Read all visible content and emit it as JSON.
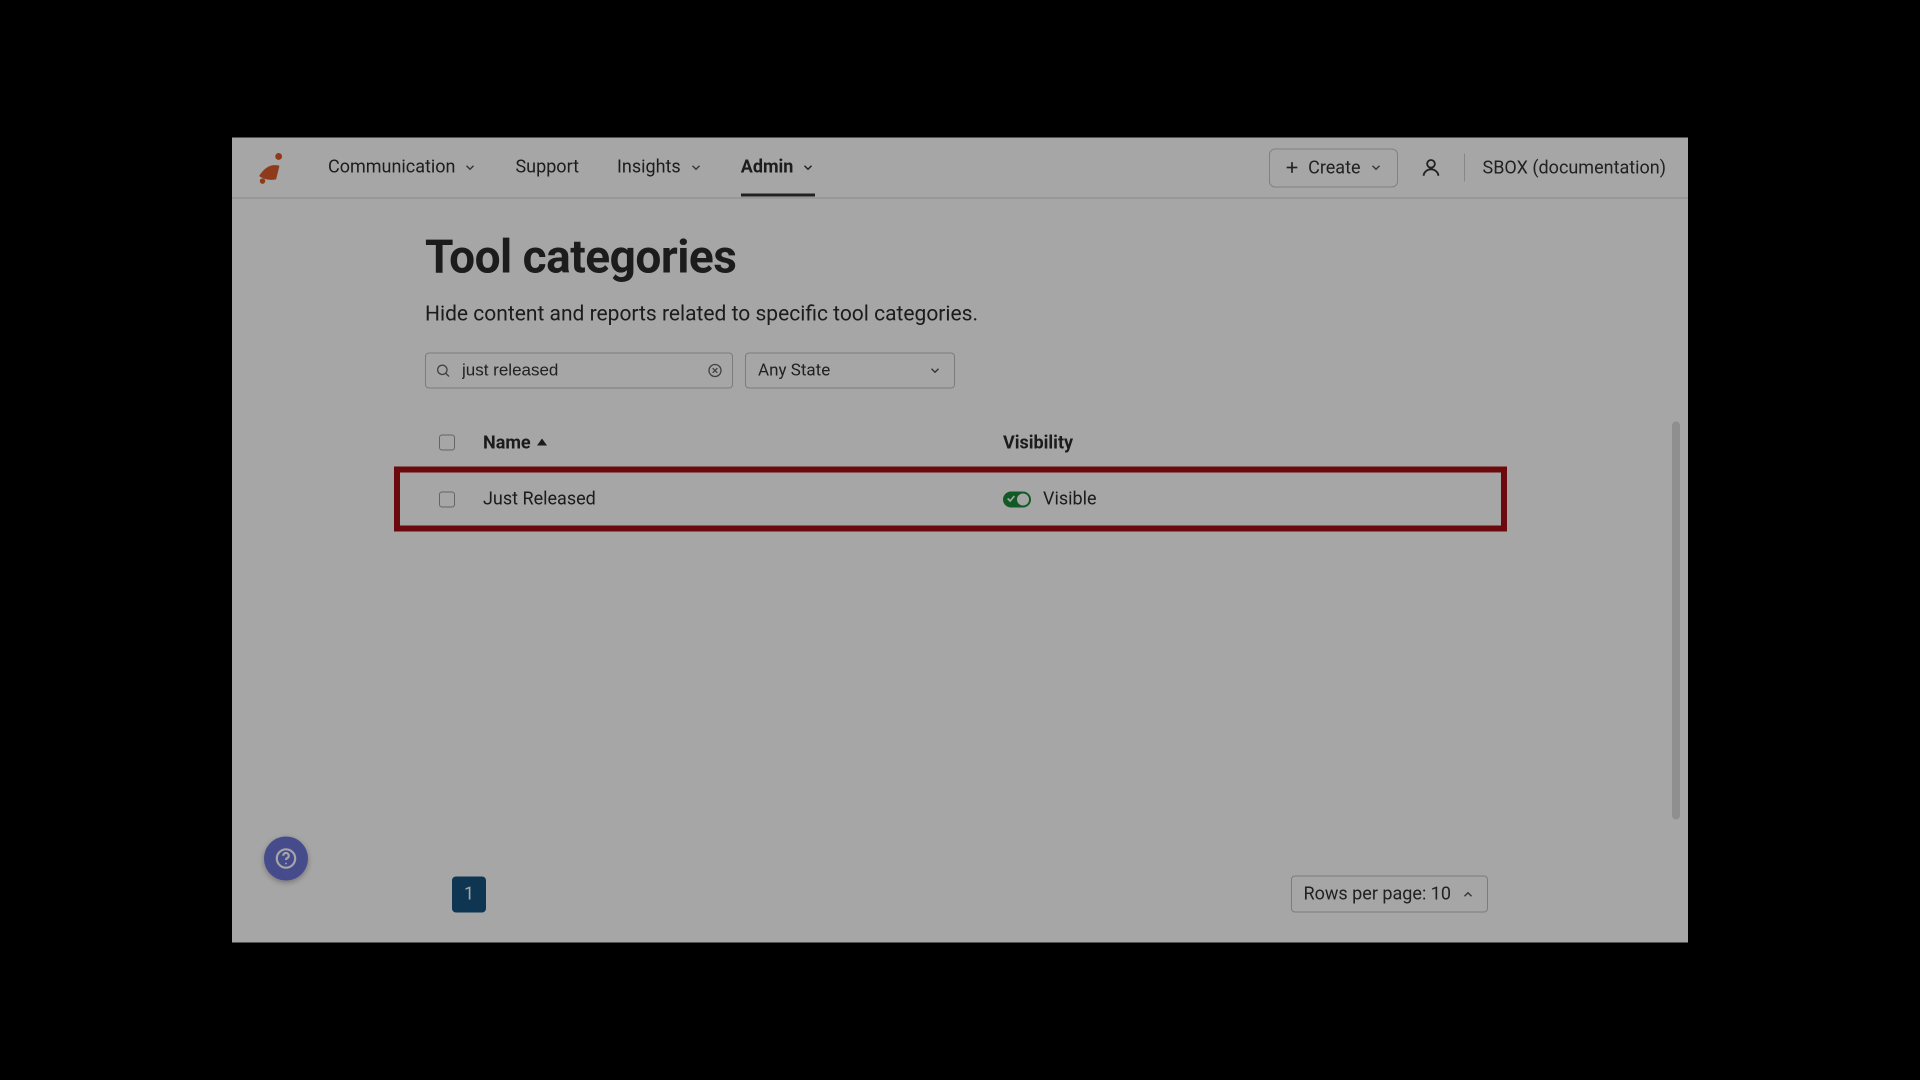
{
  "nav": {
    "communication": "Communication",
    "support": "Support",
    "insights": "Insights",
    "admin": "Admin",
    "create": "Create",
    "tenant": "SBOX (documentation)"
  },
  "page": {
    "title": "Tool categories",
    "subtitle": "Hide content and reports related to specific tool categories."
  },
  "filters": {
    "search_value": "just released",
    "state_label": "Any State"
  },
  "table": {
    "col_name": "Name",
    "col_visibility": "Visibility",
    "rows": [
      {
        "name": "Just Released",
        "visibility": "Visible",
        "toggled": true
      }
    ]
  },
  "pagination": {
    "current": "1",
    "rows_label": "Rows per page: 10"
  }
}
